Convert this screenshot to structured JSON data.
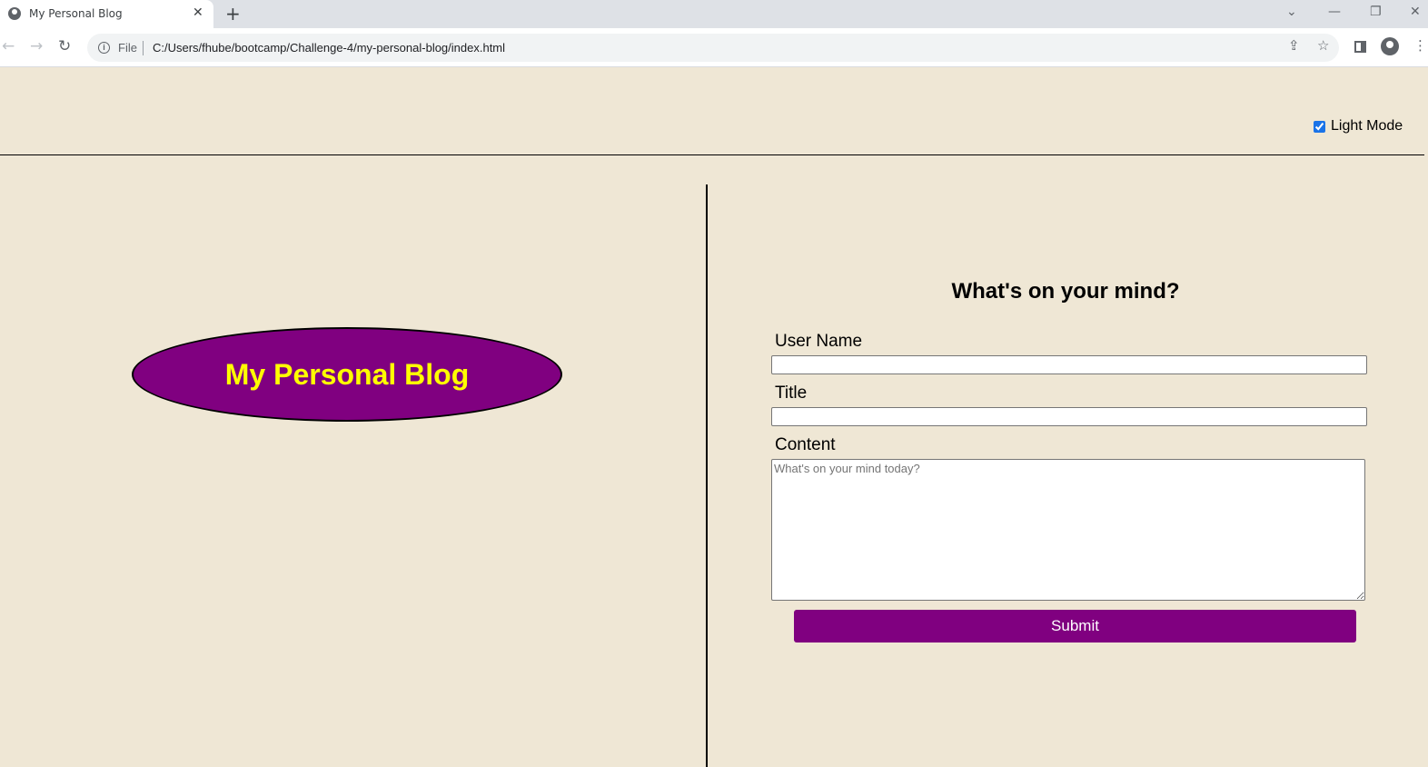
{
  "browser": {
    "tab": {
      "title": "My Personal Blog",
      "close_glyph": "✕"
    },
    "new_tab_glyph": "+",
    "window_controls": {
      "dropdown": "⌄",
      "minimize": "—",
      "restore": "❐",
      "close": "✕"
    },
    "toolbar": {
      "back_glyph": "←",
      "forward_glyph": "→",
      "reload_glyph": "↻",
      "scheme_label": "File",
      "url": "C:/Users/fhube/bootcamp/Challenge-4/my-personal-blog/index.html",
      "share_glyph": "⇪",
      "bookmark_glyph": "☆",
      "menu_glyph": "⋮"
    }
  },
  "header": {
    "mode_toggle": {
      "label": "Light Mode",
      "checked": true
    }
  },
  "hero": {
    "title": "My Personal Blog",
    "oval_color": "#800080",
    "title_color": "#ffff00"
  },
  "form": {
    "heading": "What's on your mind?",
    "username_label": "User Name",
    "username_value": "",
    "title_label": "Title",
    "title_value": "",
    "content_label": "Content",
    "content_placeholder": "What's on your mind today?",
    "submit_label": "Submit",
    "submit_color": "#800080"
  },
  "colors": {
    "page_background": "#efe7d5"
  }
}
